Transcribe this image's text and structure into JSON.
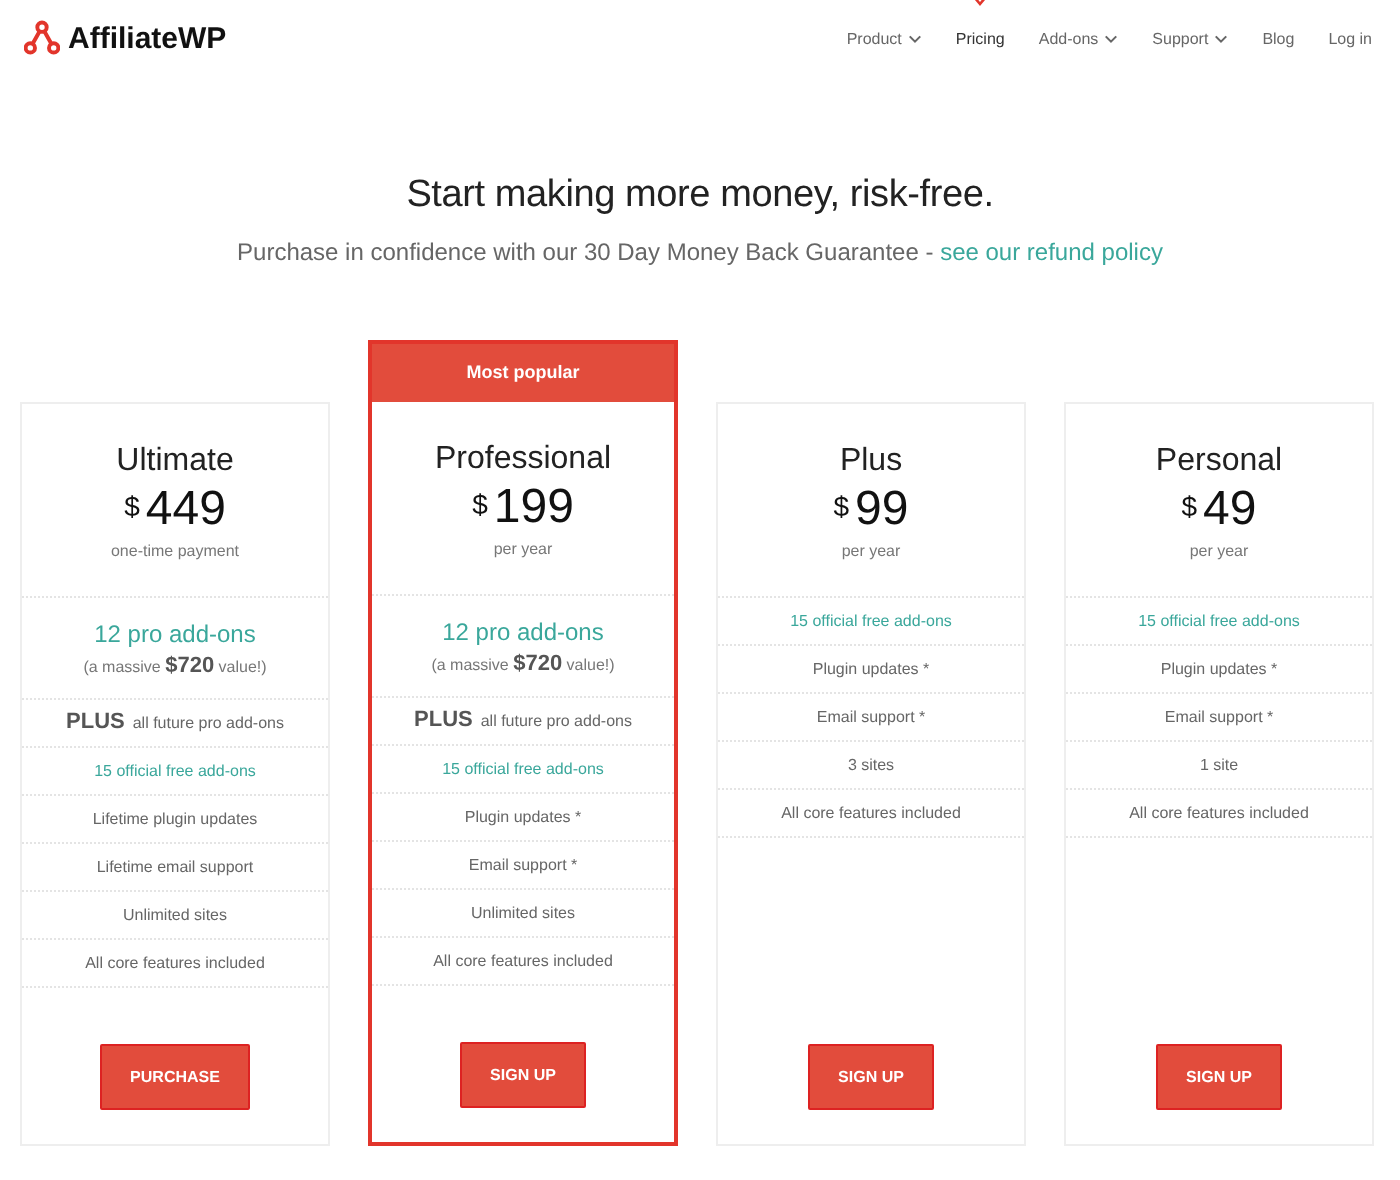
{
  "logo": {
    "text": "AffiliateWP"
  },
  "nav": [
    {
      "label": "Product",
      "dropdown": true,
      "selected": false
    },
    {
      "label": "Pricing",
      "dropdown": false,
      "selected": true
    },
    {
      "label": "Add-ons",
      "dropdown": true,
      "selected": false
    },
    {
      "label": "Support",
      "dropdown": true,
      "selected": false
    },
    {
      "label": "Blog",
      "dropdown": false,
      "selected": false
    },
    {
      "label": "Log in",
      "dropdown": false,
      "selected": false
    }
  ],
  "headline": "Start making more money, risk-free.",
  "subline": {
    "text": "Purchase in confidence with our 30 Day Money Back Guarantee - ",
    "link": "see our refund policy"
  },
  "plans": [
    {
      "name": "Ultimate",
      "currency": "$",
      "price": "449",
      "period": "one-time payment",
      "popular": false,
      "button": "PURCHASE",
      "features": [
        {
          "kind": "pro",
          "text": "12 pro add-ons",
          "note": "(a massive **$720** value!)"
        },
        {
          "kind": "plus",
          "lead": "PLUS",
          "text": "all future pro add-ons"
        },
        {
          "kind": "free",
          "text": "15 official free add-ons"
        },
        {
          "kind": "plain",
          "text": "Lifetime plugin updates"
        },
        {
          "kind": "plain",
          "text": "Lifetime email support"
        },
        {
          "kind": "plain",
          "text": "Unlimited sites"
        },
        {
          "kind": "plain",
          "text": "All core features included"
        }
      ]
    },
    {
      "name": "Professional",
      "currency": "$",
      "price": "199",
      "period": "per year",
      "popular": true,
      "badge": "Most popular",
      "button": "SIGN UP",
      "features": [
        {
          "kind": "pro",
          "text": "12 pro add-ons",
          "note": "(a massive **$720** value!)"
        },
        {
          "kind": "plus",
          "lead": "PLUS",
          "text": "all future pro add-ons"
        },
        {
          "kind": "free",
          "text": "15 official free add-ons"
        },
        {
          "kind": "plain",
          "text": "Plugin updates *"
        },
        {
          "kind": "plain",
          "text": "Email support *"
        },
        {
          "kind": "plain",
          "text": "Unlimited sites"
        },
        {
          "kind": "plain",
          "text": "All core features included"
        }
      ]
    },
    {
      "name": "Plus",
      "currency": "$",
      "price": "99",
      "period": "per year",
      "popular": false,
      "button": "SIGN UP",
      "features": [
        {
          "kind": "free",
          "text": "15 official free add-ons"
        },
        {
          "kind": "plain",
          "text": "Plugin updates *"
        },
        {
          "kind": "plain",
          "text": "Email support *"
        },
        {
          "kind": "plain",
          "text": "3 sites"
        },
        {
          "kind": "plain",
          "text": "All core features included"
        }
      ]
    },
    {
      "name": "Personal",
      "currency": "$",
      "price": "49",
      "period": "per year",
      "popular": false,
      "button": "SIGN UP",
      "features": [
        {
          "kind": "free",
          "text": "15 official free add-ons"
        },
        {
          "kind": "plain",
          "text": "Plugin updates *"
        },
        {
          "kind": "plain",
          "text": "Email support *"
        },
        {
          "kind": "plain",
          "text": "1 site"
        },
        {
          "kind": "plain",
          "text": "All core features included"
        }
      ]
    }
  ]
}
